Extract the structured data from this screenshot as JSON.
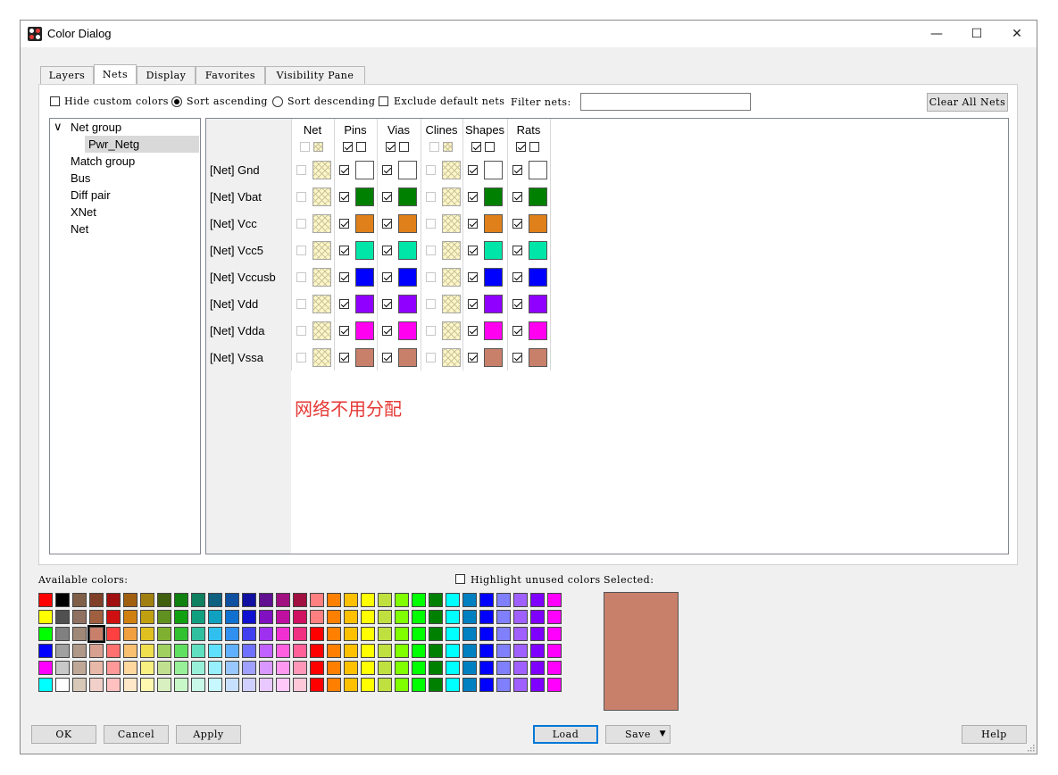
{
  "window": {
    "title": "Color Dialog",
    "minimize_glyph": "—",
    "maximize_glyph": "☐",
    "close_glyph": "✕"
  },
  "tabs": [
    "Layers",
    "Nets",
    "Display",
    "Favorites",
    "Visibility Pane"
  ],
  "active_tab": "Nets",
  "options": {
    "hide_custom_colors": {
      "label": "Hide custom colors",
      "checked": false
    },
    "sort_ascending": {
      "label": "Sort ascending",
      "selected": true
    },
    "sort_descending": {
      "label": "Sort descending",
      "selected": false
    },
    "exclude_default_nets": {
      "label": "Exclude default nets",
      "checked": false
    },
    "filter_label": "Filter nets:",
    "filter_value": "",
    "clear_all_nets": "Clear All Nets"
  },
  "tree": {
    "items": [
      {
        "label": "Net group",
        "expanded": true,
        "expander": "∨"
      },
      {
        "label": "Pwr_Netg",
        "selected": true,
        "child": true
      },
      {
        "label": "Match group"
      },
      {
        "label": "Bus"
      },
      {
        "label": "Diff pair"
      },
      {
        "label": "XNet"
      },
      {
        "label": "Net"
      }
    ]
  },
  "grid": {
    "columns": [
      "Net",
      "Pins",
      "Vias",
      "Clines",
      "Shapes",
      "Rats"
    ],
    "nets": [
      {
        "name": "[Net] Gnd",
        "color": "#ffffff"
      },
      {
        "name": "[Net] Vbat",
        "color": "#008000"
      },
      {
        "name": "[Net] Vcc",
        "color": "#e0801a"
      },
      {
        "name": "[Net] Vcc5",
        "color": "#00e6a8"
      },
      {
        "name": "[Net] Vccusb",
        "color": "#0000ff"
      },
      {
        "name": "[Net] Vdd",
        "color": "#9000ff"
      },
      {
        "name": "[Net] Vdda",
        "color": "#ff00f0"
      },
      {
        "name": "[Net] Vssa",
        "color": "#c8806a"
      }
    ]
  },
  "annotation": "网络不用分配",
  "palette": {
    "available_label": "Available colors:",
    "highlight_unused": {
      "label": "Highlight unused colors",
      "checked": false
    },
    "selected_label": "Selected:",
    "selected_color": "#c8806a",
    "rows": [
      [
        "#ff0000",
        "#000000",
        "#806048",
        "#804028",
        "#a01010",
        "#a06010",
        "#a08010",
        "#406010",
        "#108010",
        "#108060",
        "#106080",
        "#1050a0",
        "#1010a0",
        "#601090",
        "#a01080",
        "#a01040",
        "#ff8080",
        "#ff8000",
        "#ffc000",
        "#ffff00",
        "#c0e040",
        "#80ff00",
        "#00ff00",
        "#008000",
        "#00ffff",
        "#0080c0",
        "#0000ff",
        "#8080ff",
        "#a060ff",
        "#8000ff",
        "#ff00ff"
      ],
      [
        "#ffff00",
        "#505050",
        "#907060",
        "#a06040",
        "#d01010",
        "#d08010",
        "#c0a010",
        "#609020",
        "#10a010",
        "#10a080",
        "#10a0c0",
        "#1070d0",
        "#1010d0",
        "#8010c0",
        "#c010a0",
        "#d01060",
        "#ff8080",
        "#ff8000",
        "#ffc000",
        "#ffff00",
        "#c0e040",
        "#80ff00",
        "#00ff00",
        "#008000",
        "#00ffff",
        "#0080c0",
        "#0000ff",
        "#8080ff",
        "#a060ff",
        "#8000ff",
        "#ff00ff"
      ],
      [
        "#00ff00",
        "#808080",
        "#a08878",
        "#c8806a",
        "#ff4040",
        "#f0a040",
        "#e0c020",
        "#80b030",
        "#30c030",
        "#30c0a0",
        "#30c0f0",
        "#3090f0",
        "#4040f0",
        "#a030f0",
        "#f030d0",
        "#f03080",
        "#ff0000",
        "#ff8000",
        "#ffc000",
        "#ffff00",
        "#c0e040",
        "#80ff00",
        "#00ff00",
        "#008000",
        "#00ffff",
        "#0080c0",
        "#0000ff",
        "#8080ff",
        "#a060ff",
        "#8000ff",
        "#ff00ff"
      ],
      [
        "#0000ff",
        "#a0a0a0",
        "#b09888",
        "#d8a090",
        "#ff7070",
        "#f8c070",
        "#f0e050",
        "#a0d060",
        "#60e060",
        "#60e0c0",
        "#60e0ff",
        "#60b0ff",
        "#7070ff",
        "#c060ff",
        "#ff60e0",
        "#ff6098",
        "#ff0000",
        "#ff8000",
        "#ffc000",
        "#ffff00",
        "#c0e040",
        "#80ff00",
        "#00ff00",
        "#008000",
        "#00ffff",
        "#0080c0",
        "#0000ff",
        "#8080ff",
        "#a060ff",
        "#8000ff",
        "#ff00ff"
      ],
      [
        "#ff00ff",
        "#c8c8c8",
        "#c0a898",
        "#e8b8a8",
        "#ff9898",
        "#ffd8a0",
        "#f8f080",
        "#c0e090",
        "#98f098",
        "#98f0d8",
        "#98f0ff",
        "#98c8ff",
        "#a0a0ff",
        "#d898ff",
        "#ff98f0",
        "#ff98b8",
        "#ff0000",
        "#ff8000",
        "#ffc000",
        "#ffff00",
        "#c0e040",
        "#80ff00",
        "#00ff00",
        "#008000",
        "#00ffff",
        "#0080c0",
        "#0000ff",
        "#8080ff",
        "#a060ff",
        "#8000ff",
        "#ff00ff"
      ],
      [
        "#00ffff",
        "#ffffff",
        "#d8c8b8",
        "#f0d0c8",
        "#ffc0c0",
        "#ffe8c8",
        "#fff8b0",
        "#d8f0c0",
        "#c8f8c8",
        "#c8f8e8",
        "#c8f8ff",
        "#c8e0ff",
        "#d0d0ff",
        "#e8c8ff",
        "#ffc8f8",
        "#ffc8d8",
        "#ff0000",
        "#ff8000",
        "#ffc000",
        "#ffff00",
        "#c0e040",
        "#80ff00",
        "#00ff00",
        "#008000",
        "#00ffff",
        "#0080c0",
        "#0000ff",
        "#8080ff",
        "#a060ff",
        "#8000ff",
        "#ff00ff"
      ]
    ]
  },
  "buttons": {
    "ok": "OK",
    "cancel": "Cancel",
    "apply": "Apply",
    "load": "Load",
    "save": "Save",
    "save_arrow": "▼",
    "help": "Help"
  }
}
